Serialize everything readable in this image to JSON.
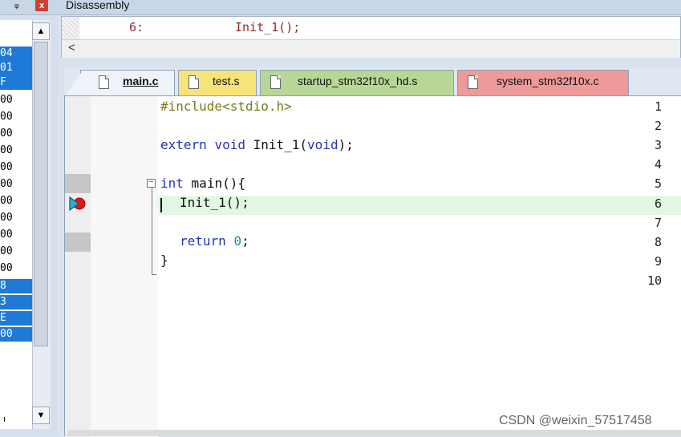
{
  "left_panel": {
    "pin_icon": "ᵩ",
    "close_label": "x",
    "register_rows": [
      {
        "text": "04",
        "selected": true
      },
      {
        "text": "01",
        "selected": true
      },
      {
        "text": "F",
        "selected": true
      },
      {
        "text": "00",
        "selected": false
      },
      {
        "text": "00",
        "selected": false
      },
      {
        "text": "00",
        "selected": false
      },
      {
        "text": "00",
        "selected": false
      },
      {
        "text": "00",
        "selected": false
      },
      {
        "text": "00",
        "selected": false
      },
      {
        "text": "00",
        "selected": false
      },
      {
        "text": "00",
        "selected": false
      },
      {
        "text": "00",
        "selected": false
      },
      {
        "text": "00",
        "selected": false
      },
      {
        "text": "00",
        "selected": false
      },
      {
        "text": "8",
        "selected": true
      },
      {
        "text": "3",
        "selected": true
      },
      {
        "text": "E",
        "selected": true
      },
      {
        "text": "00",
        "selected": true
      }
    ],
    "scroll_up": "▲",
    "scroll_down": "▼",
    "bottom_char": "ı"
  },
  "disassembly": {
    "title": "Disassembly",
    "line_number": "6:",
    "code": "Init_1();",
    "left_arrow": "<"
  },
  "tabs": [
    {
      "label": "main.c",
      "active": true
    },
    {
      "label": "test.s",
      "active": false
    },
    {
      "label": "startup_stm32f10x_hd.s",
      "active": false
    },
    {
      "label": "system_stm32f10x.c",
      "active": false
    }
  ],
  "editor": {
    "line_numbers": [
      "1",
      "2",
      "3",
      "4",
      "5",
      "6",
      "7",
      "8",
      "9",
      "10"
    ],
    "lines": {
      "l1": "#include<stdio.h>",
      "l3_kw1": "extern",
      "l3_kw2": "void",
      "l3_name": "Init_1(",
      "l3_kw3": "void",
      "l3_end": ");",
      "l5_kw": "int",
      "l5_rest": "main(){",
      "l6": "Init_1();",
      "l8_kw": "return",
      "l8_num": "0",
      "l8_end": ";",
      "l9": "}"
    },
    "fold_symbol": "−",
    "current_line": 6
  },
  "watermark": "CSDN @weixin_57517458"
}
